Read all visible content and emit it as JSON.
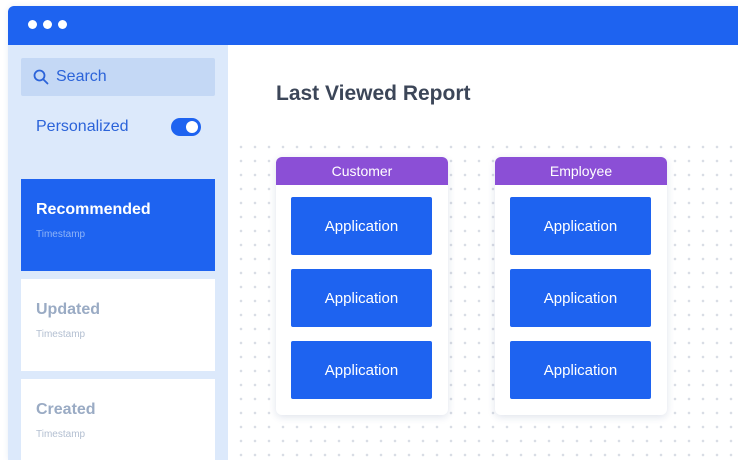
{
  "window": {
    "accent_color": "#1e63f0",
    "header_color": "#8b4fd6"
  },
  "sidebar": {
    "search": {
      "label": "Search",
      "icon": "search-icon"
    },
    "toggle": {
      "label": "Personalized",
      "state": "on"
    },
    "items": [
      {
        "title": "Recommended",
        "subtitle": "Timestamp",
        "active": true
      },
      {
        "title": "Updated",
        "subtitle": "Timestamp",
        "active": false
      },
      {
        "title": "Created",
        "subtitle": "Timestamp",
        "active": false
      }
    ]
  },
  "main": {
    "title": "Last Viewed Report",
    "panels": [
      {
        "header": "Customer",
        "apps": [
          "Application",
          "Application",
          "Application"
        ]
      },
      {
        "header": "Employee",
        "apps": [
          "Application",
          "Application",
          "Application"
        ]
      }
    ]
  }
}
